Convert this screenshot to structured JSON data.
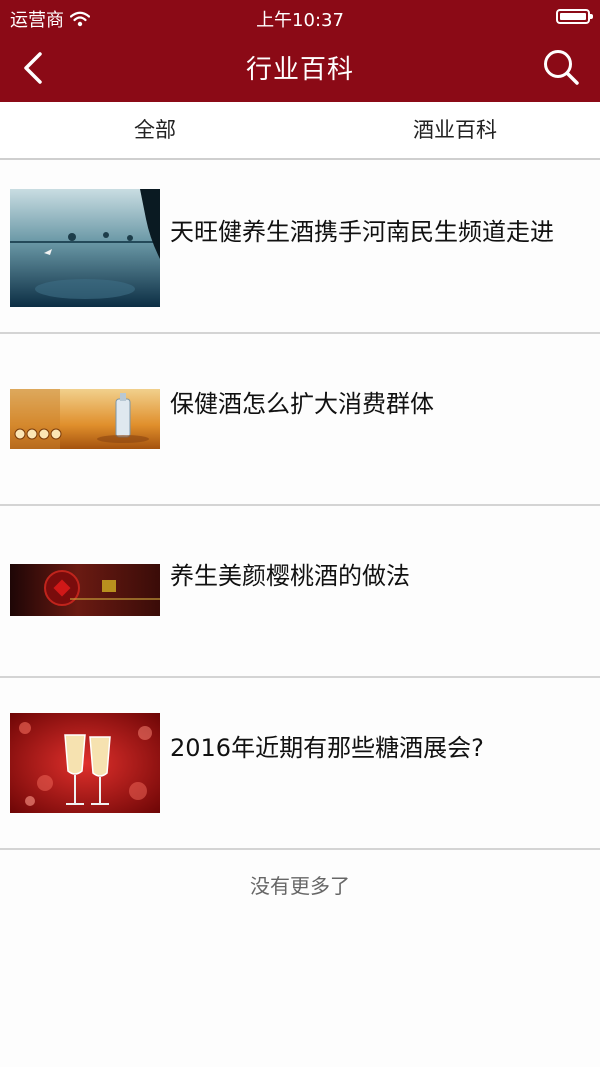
{
  "status_bar": {
    "carrier": "运营商",
    "time": "上午10:37"
  },
  "nav": {
    "title": "行业百科",
    "back_icon": "chevron-left-icon",
    "search_icon": "search-icon"
  },
  "colors": {
    "header_bg": "#8b0a16"
  },
  "tabs": [
    {
      "label": "全部"
    },
    {
      "label": "酒业百科"
    }
  ],
  "articles": [
    {
      "title": "天旺健养生酒携手河南民生频道走进",
      "thumbnail": "lake-landscape-image"
    },
    {
      "title": "保健酒怎么扩大消费群体",
      "thumbnail": "wine-bottle-banner-image"
    },
    {
      "title": "养生美颜樱桃酒的做法",
      "thumbnail": "red-wine-banner-image"
    },
    {
      "title": "2016年近期有那些糖酒展会?",
      "thumbnail": "champagne-glasses-image"
    }
  ],
  "footer": {
    "no_more": "没有更多了"
  }
}
